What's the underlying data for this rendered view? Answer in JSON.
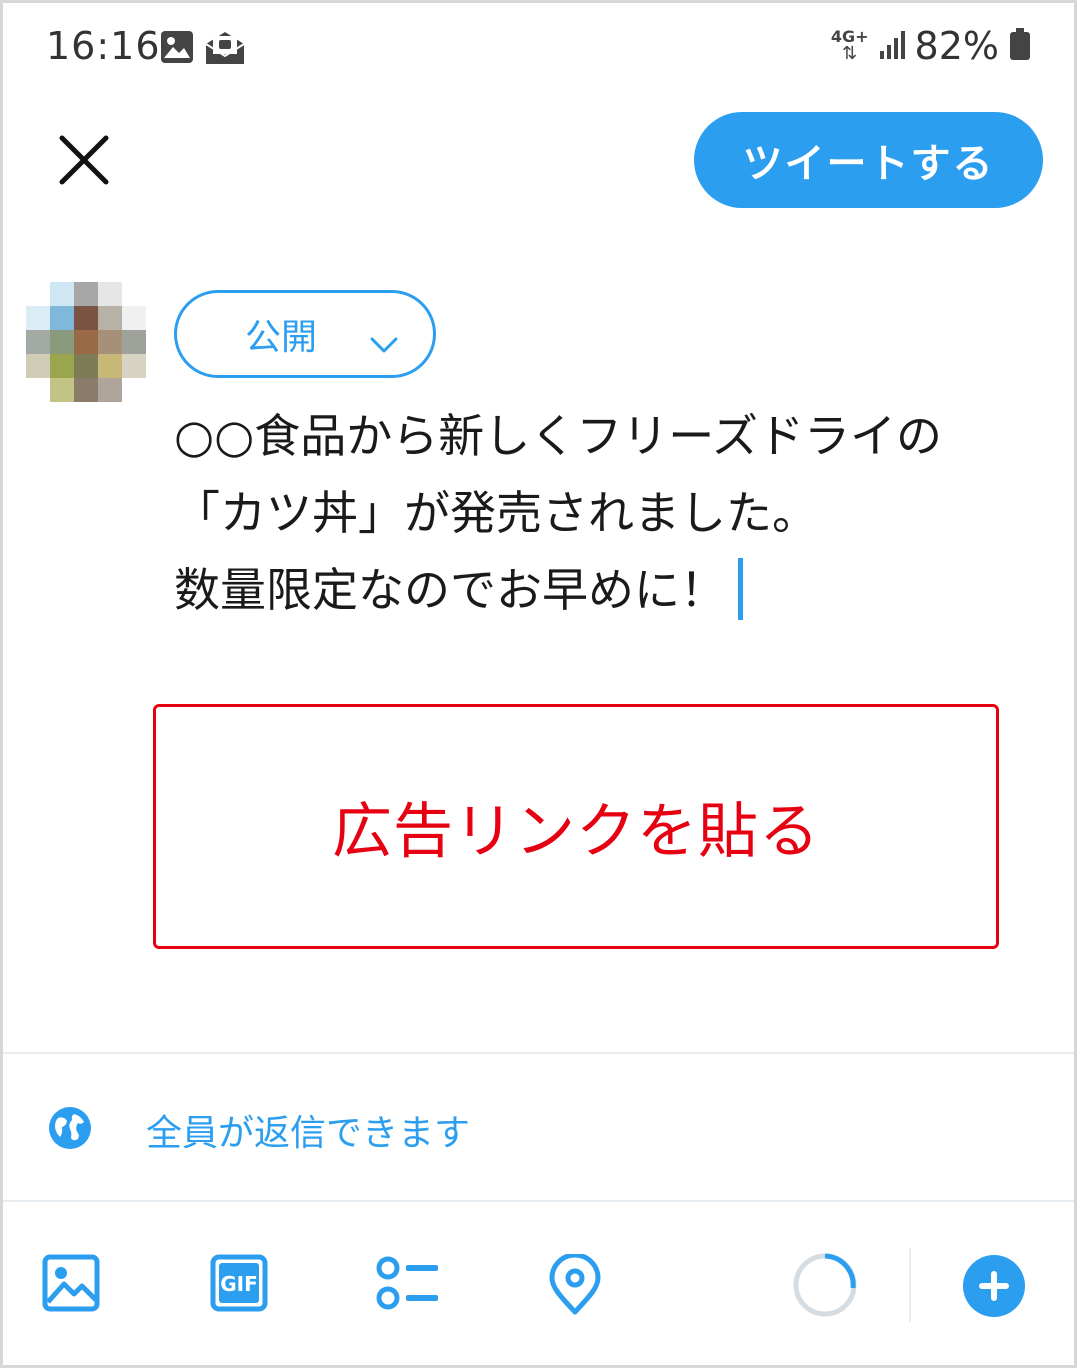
{
  "status_bar": {
    "time": "16:16",
    "network": "4G+",
    "battery": "82%"
  },
  "header": {
    "tweet_button_label": "ツイートする"
  },
  "compose": {
    "audience_label": "公開",
    "text_lines": [
      "○○食品から新しくフリーズドライの",
      "「カツ丼」が発売されました。",
      "数量限定なのでお早めに！"
    ]
  },
  "annotation": {
    "ad_box_text": "広告リンクを貼る"
  },
  "reply_setting": {
    "label": "全員が返信できます"
  },
  "colors": {
    "accent": "#2b9ef0",
    "annotation_red": "#e60012"
  },
  "toolbar": {
    "icons": [
      "image-icon",
      "gif-icon",
      "poll-icon",
      "location-icon",
      "character-count-ring",
      "add-tweet-icon"
    ],
    "gif_icon_text": "GIF"
  }
}
